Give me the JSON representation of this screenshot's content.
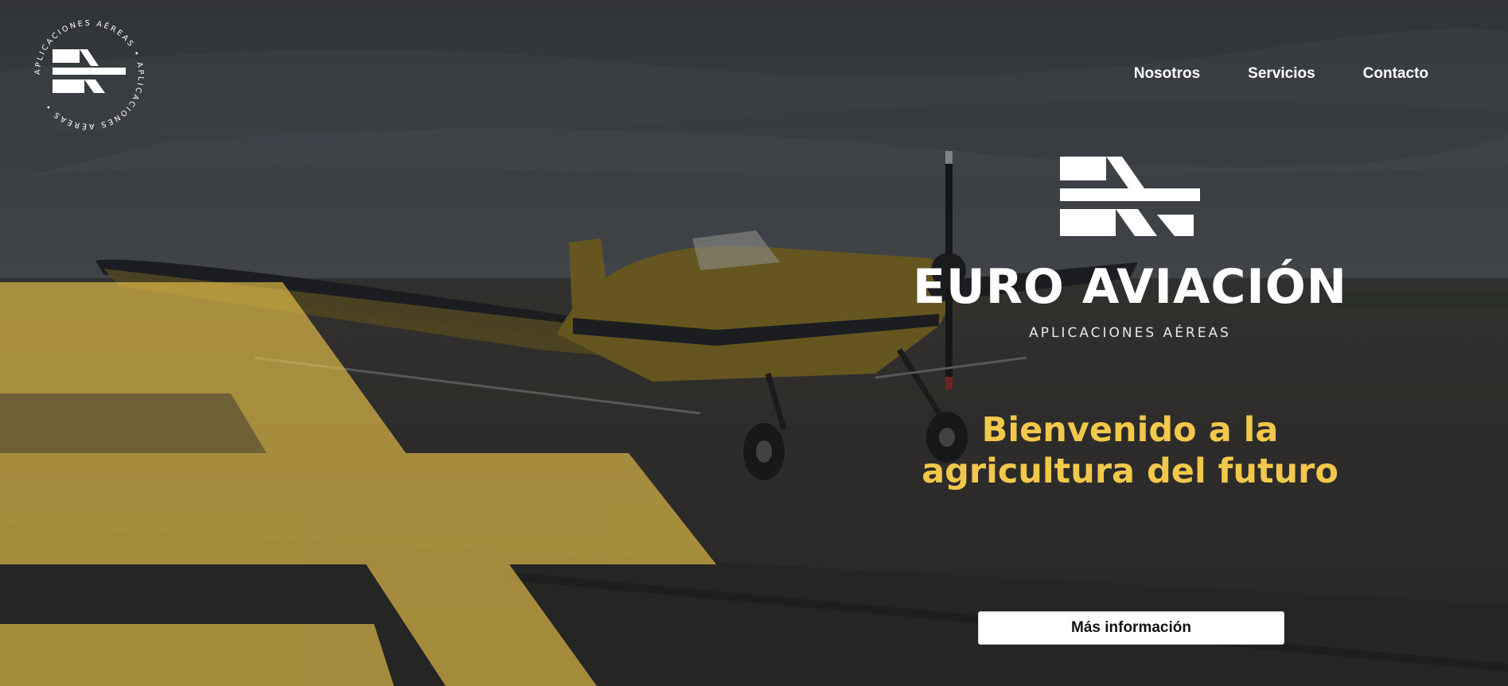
{
  "nav": {
    "items": [
      {
        "label": "Nosotros"
      },
      {
        "label": "Servicios"
      },
      {
        "label": "Contacto"
      }
    ]
  },
  "logo_badge": {
    "ring_text": "APLICACIONES AÉREAS • APLICACIONES AÉREAS •"
  },
  "brand": {
    "name": "EURO AVIACIÓN",
    "tagline": "APLICACIONES AÉREAS"
  },
  "hero": {
    "headline_line1": "Bienvenido a la",
    "headline_line2": "agricultura del futuro",
    "cta_label": "Más información"
  },
  "colors": {
    "accent_yellow": "#f2c84b",
    "overlay_dark": "#2b2d2f",
    "text_white": "#ffffff"
  }
}
